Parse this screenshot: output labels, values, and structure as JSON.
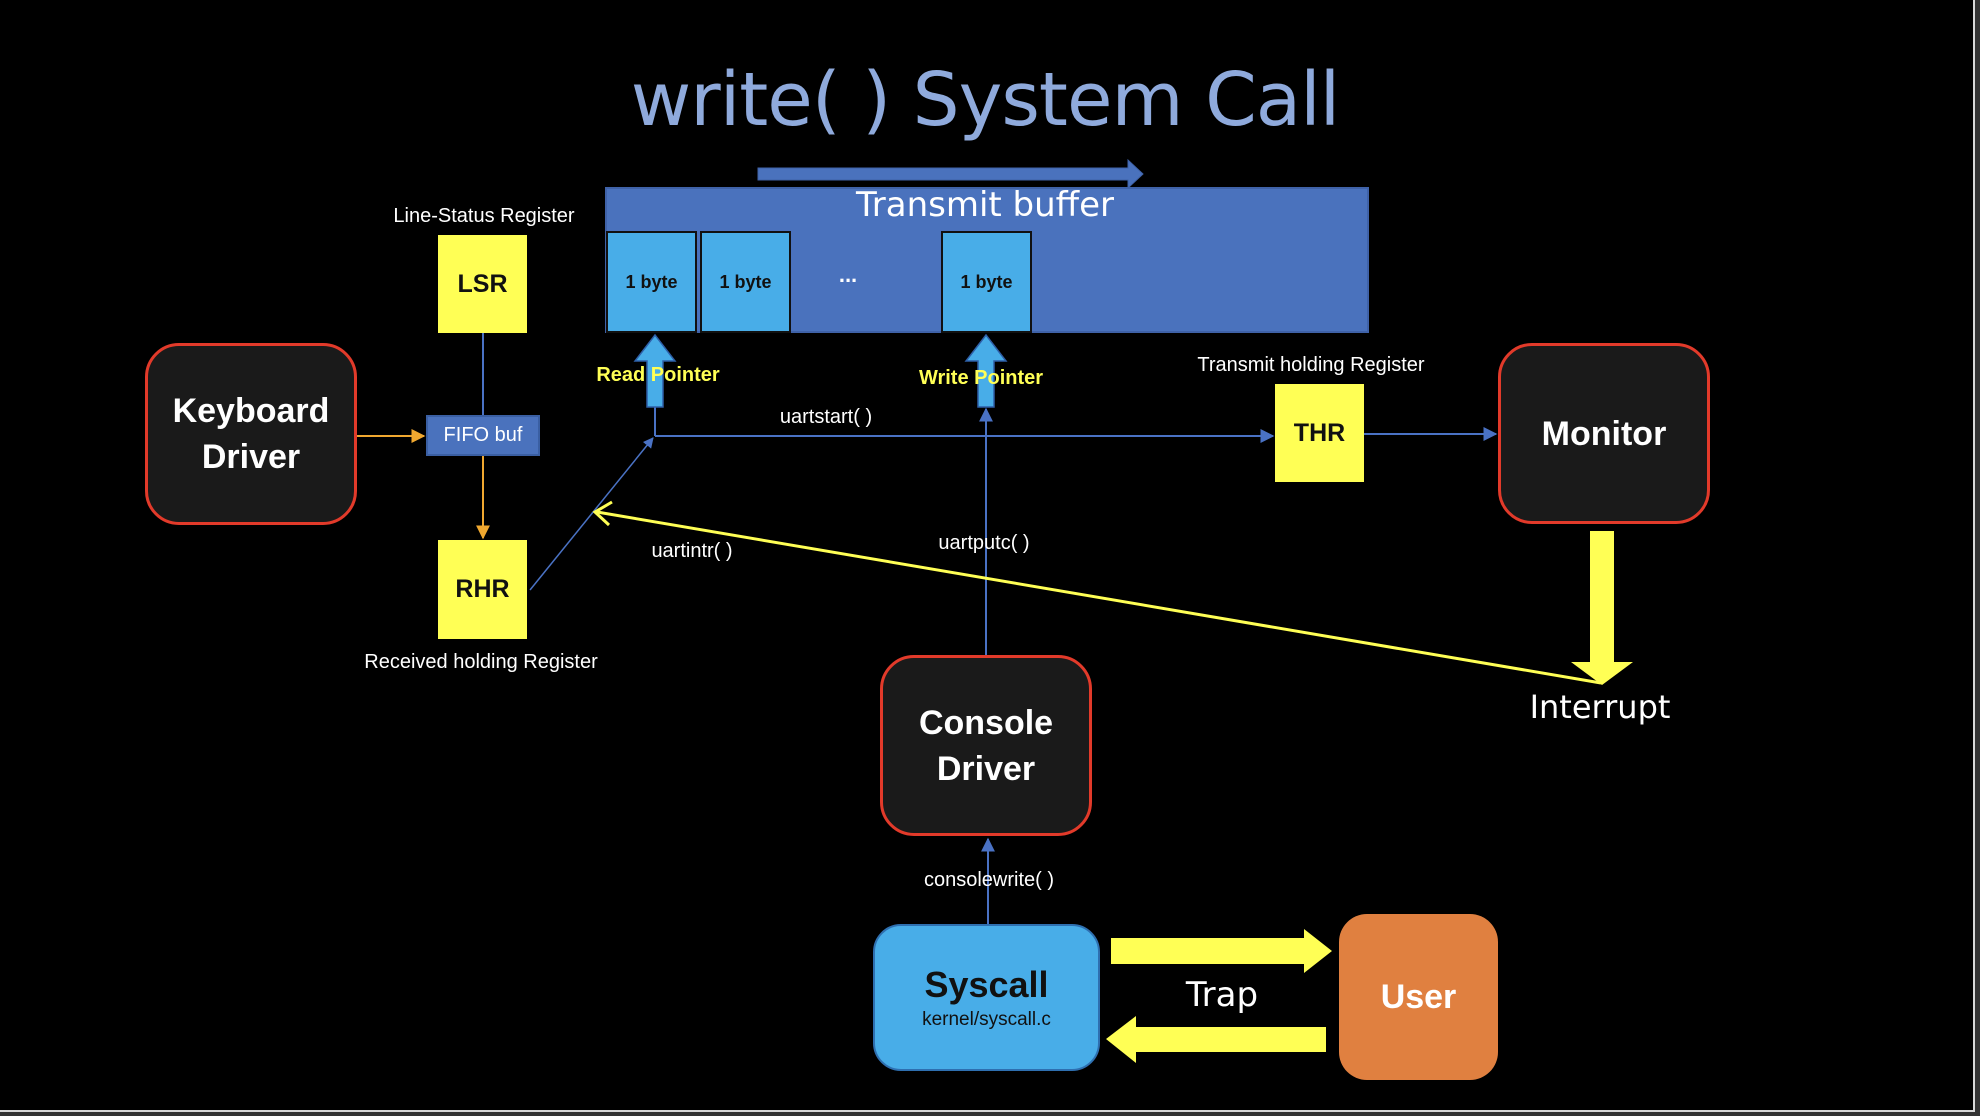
{
  "title": "write( ) System Call",
  "colors": {
    "background": "#000000",
    "title": "#8faadc",
    "buffer": "#4a72bd",
    "byte_cell": "#48ade8",
    "register": "#ffff55",
    "node_fill": "#1a1a1a",
    "node_border": "#e23a2a",
    "syscall": "#48ade8",
    "user": "#e08040",
    "wire_blue": "#4a72c4",
    "wire_orange": "#f0a830",
    "interrupt_yellow": "#ffff55"
  },
  "transmit_buffer": {
    "label": "Transmit buffer",
    "cells": [
      "1 byte",
      "1 byte",
      "1 byte"
    ],
    "ellipsis": "..."
  },
  "pointers": {
    "read": "Read Pointer",
    "write": "Write Pointer"
  },
  "registers": {
    "lsr": {
      "short": "LSR",
      "label": "Line-Status Register"
    },
    "rhr": {
      "short": "RHR",
      "label": "Received holding Register"
    },
    "thr": {
      "short": "THR",
      "label": "Transmit holding Register"
    },
    "fifo": "FIFO buf"
  },
  "nodes": {
    "keyboard_driver": [
      "Keyboard",
      "Driver"
    ],
    "monitor": "Monitor",
    "console_driver": [
      "Console",
      "Driver"
    ],
    "syscall": {
      "name": "Syscall",
      "file": "kernel/syscall.c"
    },
    "user": "User"
  },
  "functions": {
    "uartstart": "uartstart( )",
    "uartintr": "uartintr( )",
    "uartputc": "uartputc( )",
    "consolewrite": "consolewrite( )"
  },
  "labels": {
    "trap": "Trap",
    "interrupt": "Interrupt"
  }
}
